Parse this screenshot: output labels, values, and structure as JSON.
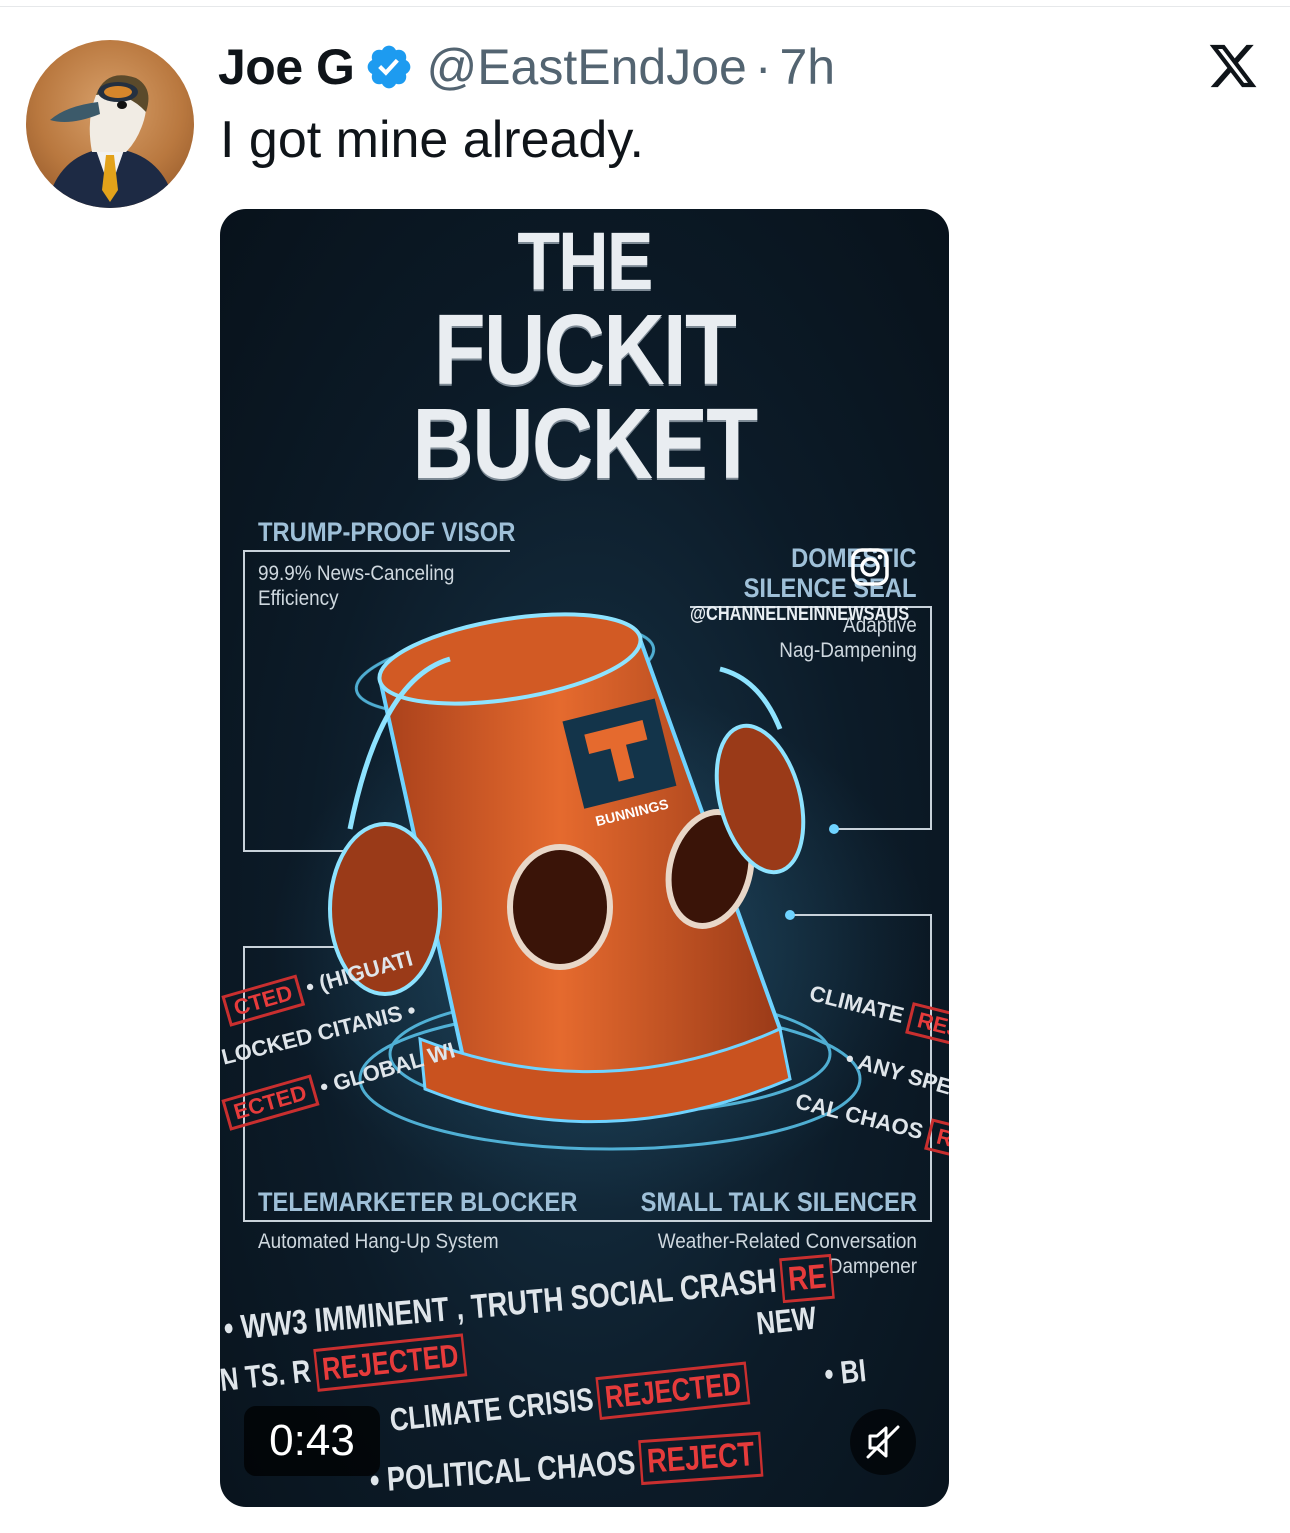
{
  "tweet": {
    "author_name": "Joe G",
    "handle": "@EastEndJoe",
    "separator": "·",
    "time": "7h",
    "text": "I got mine already."
  },
  "icons": {
    "avatar": "duck-in-suit-avatar",
    "verified": "verified-badge-icon",
    "platform": "x-logo-icon",
    "mute": "muted-speaker-icon"
  },
  "colors": {
    "verified_blue": "#1d9bf0",
    "text_primary": "#0f1419",
    "text_secondary": "#536471",
    "bucket_orange": "#e0642a",
    "rejected_red": "#e63b3b"
  },
  "video": {
    "duration": "0:43",
    "poster": {
      "title_lines": [
        "THE",
        "FUCKIT",
        "BUCKET"
      ],
      "brand": "BUNNINGS",
      "watermark": "@CHANNELNEINNEWSAUS",
      "features": {
        "visor_title": "TRUMP-PROOF VISOR",
        "visor_sub": [
          "99.9% News-Canceling",
          "Efficiency"
        ],
        "seal_title": [
          "DOMESTIC",
          "SILENCE SEAL"
        ],
        "seal_sub": [
          "Adaptive",
          "Nag-Dampening"
        ],
        "tele_title": "TELEMARKETER BLOCKER",
        "tele_sub": "Automated Hang-Up System",
        "small_title": "SMALL TALK SILENCER",
        "small_sub": [
          "Weather-Related Conversation",
          "Dampener"
        ]
      },
      "ring_left": [
        "CTED",
        "• (HIGUATI",
        "LOCKED CITANIS •",
        "ECTED",
        "• GLOBAL WI"
      ],
      "ring_right": [
        "CLIMATE",
        "REJECT",
        "• ANY SPEN",
        "CAL CHAOS",
        "REJECT"
      ],
      "ring_bottom": {
        "line1": "• WW3 IMMINENT , TRUTH SOCIAL CRASH",
        "line1_tag": "RE",
        "line2_pre": "N TS. R",
        "line2_tag": "REJECTED",
        "line2_post": "NEW",
        "line3_pre": "CLIMATE CRISIS",
        "line3_tag": "REJECTED",
        "line3_post": "• BI",
        "line4_pre": "• POLITICAL CHAOS",
        "line4_tag": "REJECT"
      }
    }
  }
}
